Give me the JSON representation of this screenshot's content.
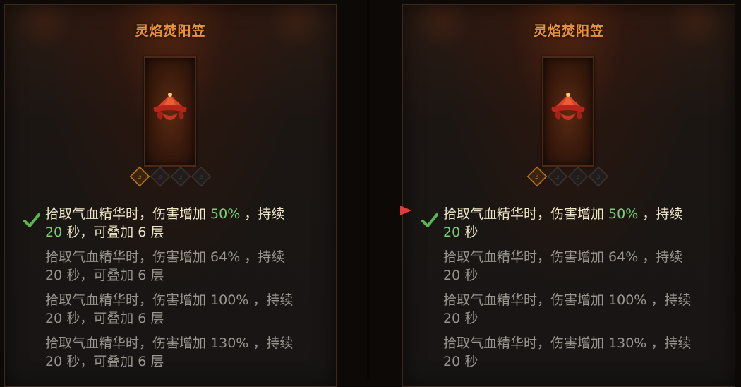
{
  "panels": [
    {
      "title": "灵焰焚阳笠",
      "tiers": [
        {
          "a": "拾取气血精华时，伤害增加 ",
          "pct": "50%",
          "b": " ，持续",
          "n": "20",
          "c": " 秒，可叠加 ",
          "s": "6",
          "d": " 层"
        },
        {
          "a": "拾取气血精华时，伤害增加 ",
          "pct": "64%",
          "b": " ，持续",
          "n": "20",
          "c": " 秒，可叠加 ",
          "s": "6",
          "d": " 层"
        },
        {
          "a": "拾取气血精华时，伤害增加 ",
          "pct": "100%",
          "b": " ，持续",
          "n": "20",
          "c": " 秒，可叠加 ",
          "s": "6",
          "d": " 层"
        },
        {
          "a": "拾取气血精华时，伤害增加 ",
          "pct": "130%",
          "b": " ，持续",
          "n": "20",
          "c": " 秒，可叠加 ",
          "s": "6",
          "d": " 层"
        }
      ]
    },
    {
      "title": "灵焰焚阳笠",
      "tiers": [
        {
          "a": "拾取气血精华时，伤害增加 ",
          "pct": "50%",
          "b": " ，持续",
          "n": "20",
          "c": " 秒",
          "s": "",
          "d": ""
        },
        {
          "a": "拾取气血精华时，伤害增加 ",
          "pct": "64%",
          "b": " ，持续",
          "n": "20",
          "c": " 秒",
          "s": "",
          "d": ""
        },
        {
          "a": "拾取气血精华时，伤害增加 ",
          "pct": "100%",
          "b": " ，持续",
          "n": "20",
          "c": " 秒",
          "s": "",
          "d": ""
        },
        {
          "a": "拾取气血精华时，伤害增加 ",
          "pct": "130%",
          "b": " ，持续",
          "n": "20",
          "c": " 秒",
          "s": "",
          "d": ""
        }
      ]
    }
  ],
  "colors": {
    "title": "#e8933c",
    "highlight": "#7ccf74",
    "active_text": "#efe6c8",
    "inactive_text": "#9a958e",
    "arrow": "#e8393a"
  },
  "icons": {
    "check": "checkmark-icon",
    "gem": "rune-gem-icon",
    "item": "straw-hat-icon",
    "arrow": "red-arrow-icon"
  },
  "active_gems": 1,
  "total_gems": 4
}
